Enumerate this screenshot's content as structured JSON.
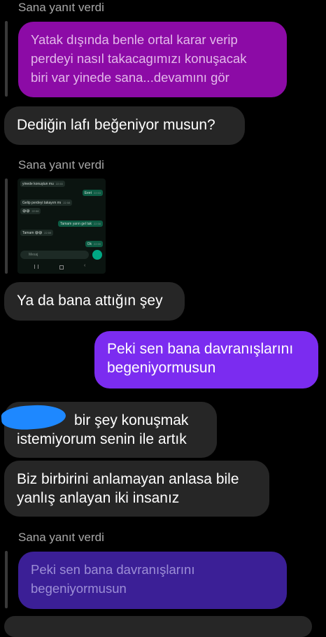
{
  "messages": {
    "caption1": "Sana yanıt verdi",
    "quoted1": {
      "lines": [
        "Yatak dışında benle ortal karar verip",
        "perdeyi nasıl takacagımızı konuşacak",
        "biri var yinede sana...devamını gör"
      ],
      "bg": "#8c0ba6",
      "color": "#e3b9ea"
    },
    "msg1": "Dediğin lafı beğeniyor musun?",
    "caption2": "Sana yanıt verdi",
    "thumbnail": {
      "rows": [
        {
          "text": "yinede konuştun mu",
          "time": "22:53",
          "side": "in"
        },
        {
          "text": "Eeet",
          "time": "22:53",
          "side": "out"
        },
        {
          "text": "Gelip perdeyi takayım mı",
          "time": "22:58",
          "side": "in"
        },
        {
          "text": "😅😅",
          "time": "22:58",
          "side": "in"
        },
        {
          "text": "Tamam yarın gel tak",
          "time": "22:58",
          "side": "out"
        },
        {
          "text": "Tamam 😅😅",
          "time": "22:59",
          "side": "in"
        },
        {
          "text": "Ok",
          "time": "22:59",
          "side": "out"
        }
      ],
      "input_placeholder": "Mesaj"
    },
    "msg2": "Ya da bana attığın şey",
    "msg3_out": [
      "Peki sen bana davranışlarını",
      "begeniyormusun"
    ],
    "msg4": [
      "bir şey konuşmak",
      "istemiyorum senin ile artık"
    ],
    "msg5": [
      "Biz birbirini anlamayan anlasa bile",
      "yanlış anlayan iki insanız"
    ],
    "caption3": "Sana yanıt verdi",
    "quoted2": {
      "lines": [
        "Peki sen bana davranışlarını",
        "begeniyormusun"
      ],
      "bg": "#3b1f96",
      "color": "#9c8ed6"
    }
  },
  "colors": {
    "background": "#000000",
    "incoming_bubble": "#262626",
    "outgoing_bubble": "#7b2cf0",
    "redaction": "#1e88ff"
  }
}
